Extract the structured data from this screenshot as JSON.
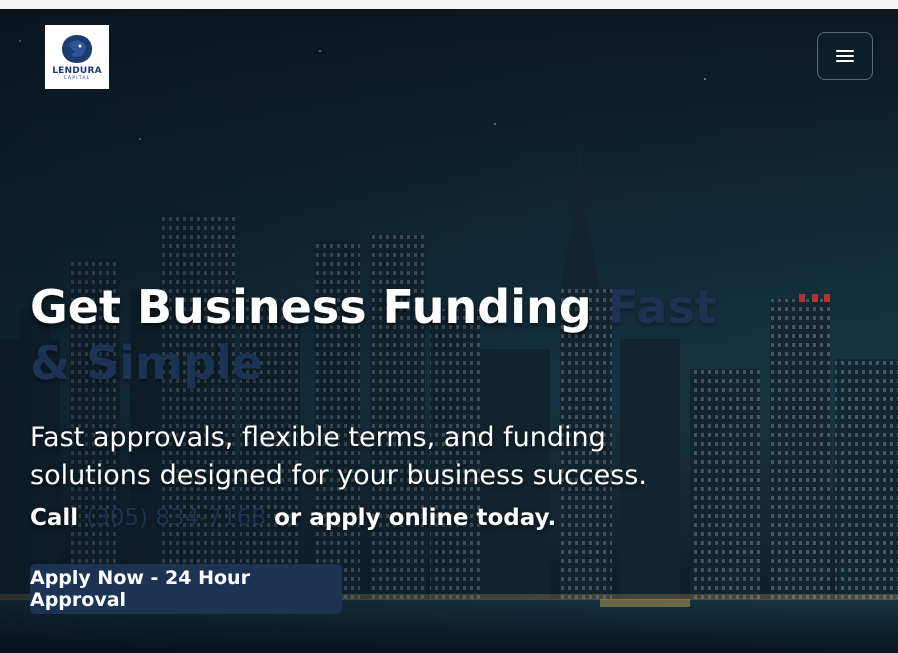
{
  "brand": {
    "logo_icon": "lion-head-icon",
    "name": "LENDURA",
    "subtitle": "CAPITAL",
    "color": "#1e3a6e"
  },
  "nav": {
    "menu_icon": "hamburger-menu-icon"
  },
  "hero": {
    "headline_main": "Get Business Funding ",
    "headline_accent": "Fast & Simple",
    "subheadline": "Fast approvals, flexible terms, and funding solutions designed for your business success.",
    "call_prefix": "Call ",
    "phone": "(305) 834-7168",
    "call_suffix": " or apply online today.",
    "cta_label": "Apply Now - 24 Hour Approval",
    "background": "night-city-skyline-photo"
  },
  "colors": {
    "accent": "#1c3354",
    "text": "#ffffff",
    "menu_bg": "#0f1f2a"
  }
}
